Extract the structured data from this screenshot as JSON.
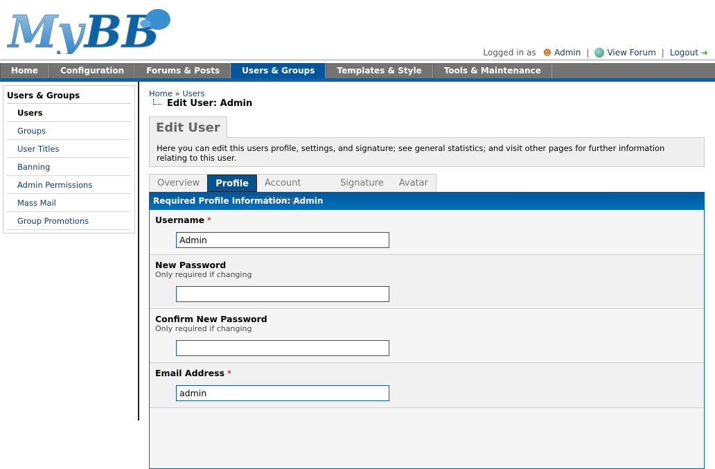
{
  "logo": {
    "text": "MyBB"
  },
  "userbar": {
    "logged_in_as": "Logged in as",
    "user": "Admin",
    "view_forum": "View Forum",
    "logout": "Logout",
    "sep": "|"
  },
  "nav": [
    "Home",
    "Configuration",
    "Forums & Posts",
    "Users & Groups",
    "Templates & Style",
    "Tools & Maintenance"
  ],
  "sidebar": {
    "title": "Users & Groups",
    "items": [
      "Users",
      "Groups",
      "User Titles",
      "Banning",
      "Admin Permissions",
      "Mass Mail",
      "Group Promotions"
    ]
  },
  "breadcrumb": {
    "home": "Home",
    "sep": "»",
    "users": "Users",
    "current": "Edit User: Admin"
  },
  "page": {
    "title": "Edit User",
    "description": "Here you can edit this users profile, settings, and signature; see general statistics; and visit other pages for further information relating to this user."
  },
  "tabs": [
    "Overview",
    "Profile",
    "Account Settings",
    "Signature",
    "Avatar"
  ],
  "form": {
    "header": "Required Profile Information: Admin",
    "fields": [
      {
        "label": "Username",
        "required": "*",
        "hint": "",
        "value": ""
      },
      {
        "label": "New Password",
        "required": "",
        "hint": "Only required if changing",
        "value": ""
      },
      {
        "label": "Confirm New Password",
        "required": "",
        "hint": "Only required if changing",
        "value": ""
      },
      {
        "label": "Email Address",
        "required": "*",
        "hint": "",
        "value": ""
      }
    ],
    "username_value": "Admin",
    "email_value": "admin"
  }
}
